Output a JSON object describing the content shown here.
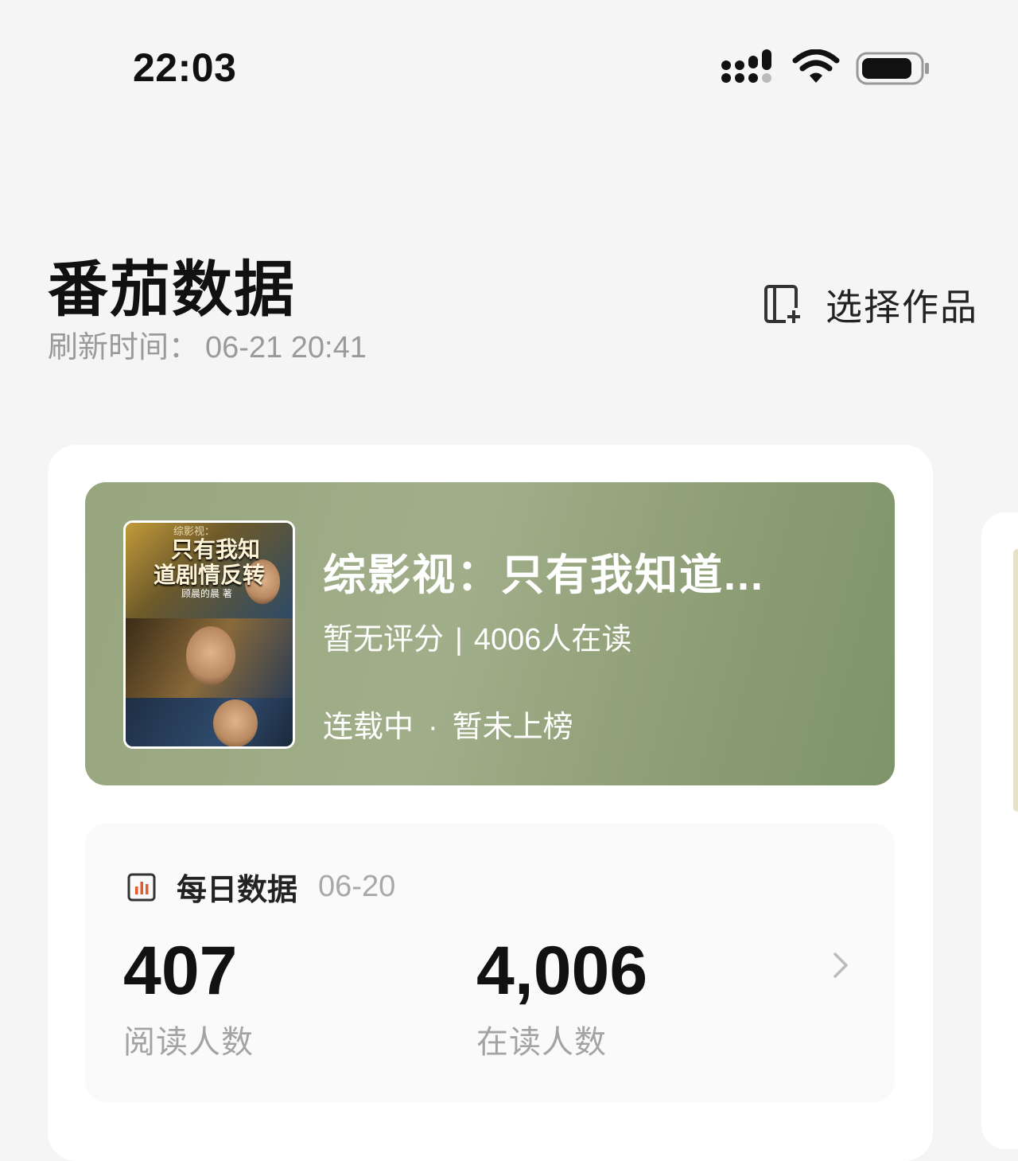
{
  "status_bar": {
    "time": "22:03",
    "icons": [
      "signal-icon",
      "wifi-icon",
      "battery-icon"
    ]
  },
  "header": {
    "title": "番茄数据",
    "refresh_label": "刷新时间：",
    "refresh_time": "06-21 20:41",
    "select_work_label": "选择作品"
  },
  "book": {
    "title": "综影视：只有我知道...",
    "rating": "暂无评分",
    "readers_text": "4006人在读",
    "serial_status": "连载中",
    "rank_status": "暂未上榜",
    "cover": {
      "top_text": "综影视：",
      "title_line1": "只有我知",
      "title_line2": "道剧情反转",
      "author": "顾晨的晨  著"
    }
  },
  "daily": {
    "title": "每日数据",
    "date": "06-20",
    "stats": [
      {
        "value": "407",
        "label": "阅读人数"
      },
      {
        "value": "4,006",
        "label": "在读人数"
      }
    ]
  },
  "colors": {
    "banner": "#97a67e",
    "background": "#f5f5f5",
    "card": "#ffffff",
    "accent_icon": "#e45b2c"
  }
}
